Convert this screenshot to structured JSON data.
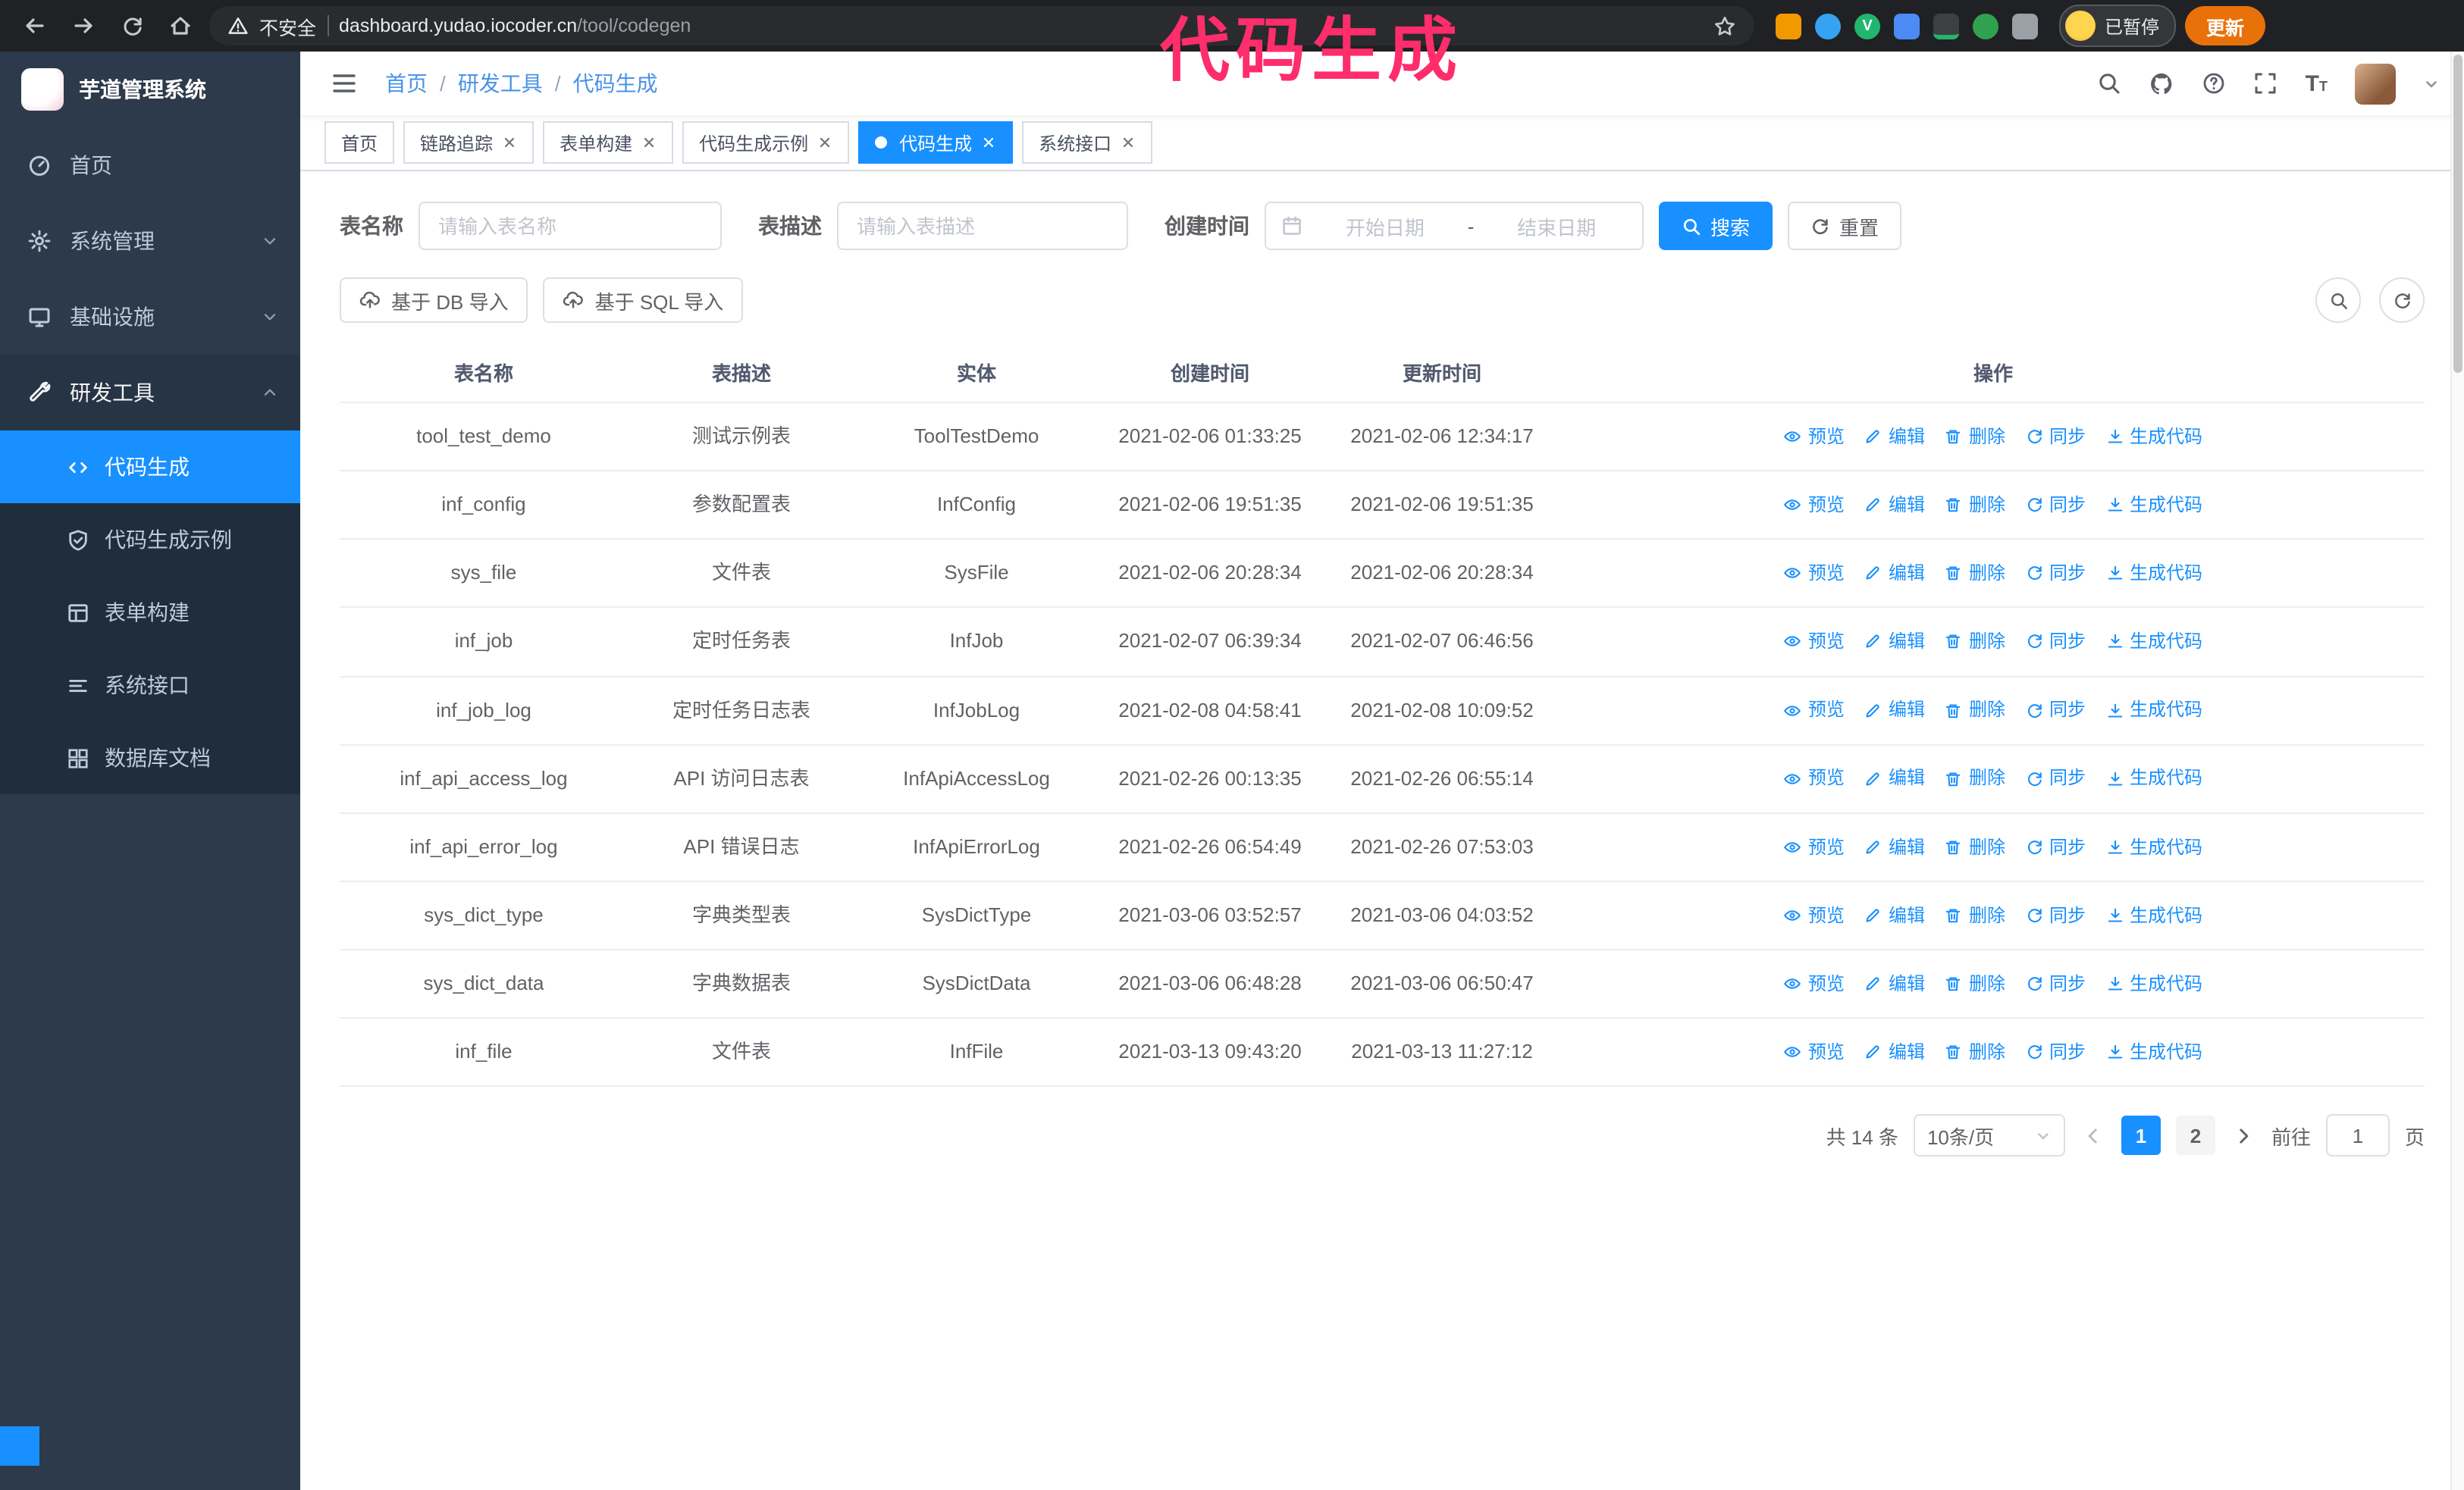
{
  "chrome": {
    "security_label": "不安全",
    "url_host": "dashboard.yudao.iocoder.cn",
    "url_path": "/tool/codegen",
    "profile_status": "已暂停",
    "update_label": "更新"
  },
  "annotation": {
    "text": "代码生成"
  },
  "sidebar": {
    "logo_title": "芋道管理系统",
    "items": [
      {
        "label": "首页"
      },
      {
        "label": "系统管理"
      },
      {
        "label": "基础设施"
      },
      {
        "label": "研发工具"
      }
    ],
    "subitems": [
      {
        "label": "代码生成"
      },
      {
        "label": "代码生成示例"
      },
      {
        "label": "表单构建"
      },
      {
        "label": "系统接口"
      },
      {
        "label": "数据库文档"
      }
    ]
  },
  "navbar": {
    "breadcrumb": [
      "首页",
      "研发工具",
      "代码生成"
    ]
  },
  "tabs": [
    {
      "label": "首页"
    },
    {
      "label": "链路追踪"
    },
    {
      "label": "表单构建"
    },
    {
      "label": "代码生成示例"
    },
    {
      "label": "代码生成"
    },
    {
      "label": "系统接口"
    }
  ],
  "filters": {
    "name_label": "表名称",
    "name_placeholder": "请输入表名称",
    "desc_label": "表描述",
    "desc_placeholder": "请输入表描述",
    "time_label": "创建时间",
    "start_placeholder": "开始日期",
    "range_separator": "-",
    "end_placeholder": "结束日期",
    "search_label": "搜索",
    "reset_label": "重置"
  },
  "toolbar": {
    "import_db_label": "基于 DB 导入",
    "import_sql_label": "基于 SQL 导入"
  },
  "table": {
    "columns": [
      "表名称",
      "表描述",
      "实体",
      "创建时间",
      "更新时间",
      "操作"
    ],
    "actions": [
      "预览",
      "编辑",
      "删除",
      "同步",
      "生成代码"
    ],
    "rows": [
      {
        "name": "tool_test_demo",
        "desc": "测试示例表",
        "entity": "ToolTestDemo",
        "created": "2021-02-06 01:33:25",
        "updated": "2021-02-06 12:34:17"
      },
      {
        "name": "inf_config",
        "desc": "参数配置表",
        "entity": "InfConfig",
        "created": "2021-02-06 19:51:35",
        "updated": "2021-02-06 19:51:35"
      },
      {
        "name": "sys_file",
        "desc": "文件表",
        "entity": "SysFile",
        "created": "2021-02-06 20:28:34",
        "updated": "2021-02-06 20:28:34"
      },
      {
        "name": "inf_job",
        "desc": "定时任务表",
        "entity": "InfJob",
        "created": "2021-02-07 06:39:34",
        "updated": "2021-02-07 06:46:56"
      },
      {
        "name": "inf_job_log",
        "desc": "定时任务日志表",
        "entity": "InfJobLog",
        "created": "2021-02-08 04:58:41",
        "updated": "2021-02-08 10:09:52"
      },
      {
        "name": "inf_api_access_log",
        "desc": "API 访问日志表",
        "entity": "InfApiAccessLog",
        "created": "2021-02-26 00:13:35",
        "updated": "2021-02-26 06:55:14"
      },
      {
        "name": "inf_api_error_log",
        "desc": "API 错误日志",
        "entity": "InfApiErrorLog",
        "created": "2021-02-26 06:54:49",
        "updated": "2021-02-26 07:53:03"
      },
      {
        "name": "sys_dict_type",
        "desc": "字典类型表",
        "entity": "SysDictType",
        "created": "2021-03-06 03:52:57",
        "updated": "2021-03-06 04:03:52"
      },
      {
        "name": "sys_dict_data",
        "desc": "字典数据表",
        "entity": "SysDictData",
        "created": "2021-03-06 06:48:28",
        "updated": "2021-03-06 06:50:47"
      },
      {
        "name": "inf_file",
        "desc": "文件表",
        "entity": "InfFile",
        "created": "2021-03-13 09:43:20",
        "updated": "2021-03-13 11:27:12"
      }
    ]
  },
  "pagination": {
    "total": "共 14 条",
    "page_size": "10条/页",
    "pages": [
      "1",
      "2"
    ],
    "goto_label": "前往",
    "goto_value": "1",
    "unit_label": "页"
  },
  "colors": {
    "accent": "#1890ff",
    "annotation": "#ff2d6b",
    "sidebar_bg": "#2d3a4b",
    "submenu_bg": "#1f2d3c"
  }
}
